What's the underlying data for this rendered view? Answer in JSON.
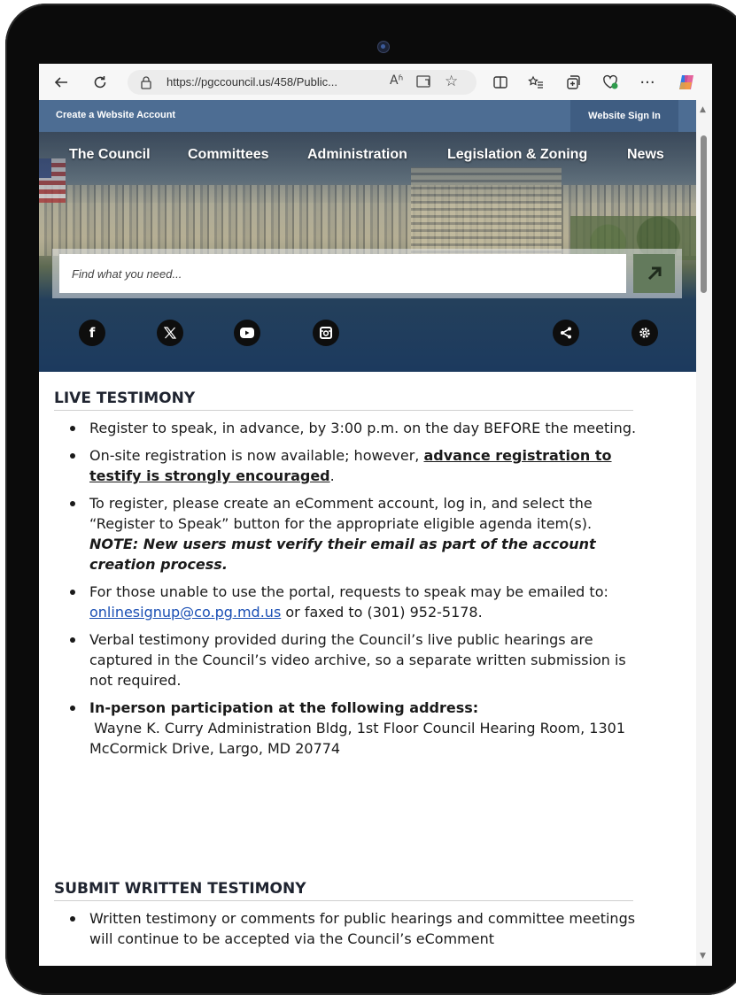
{
  "browser": {
    "url": "https://pgccouncil.us/458/Public...",
    "read_aloud_label": "Aʱ",
    "more_label": "···"
  },
  "site": {
    "topbar": {
      "create_account": "Create a Website Account",
      "sign_in": "Website Sign In"
    },
    "nav": [
      "The Council",
      "Committees",
      "Administration",
      "Legislation & Zoning",
      "News"
    ],
    "search_placeholder": "Find what you need...",
    "socials": [
      "facebook-icon",
      "x-icon",
      "youtube-icon",
      "instagram-icon"
    ],
    "right_icons": [
      "share-icon",
      "settings-icon"
    ]
  },
  "live_testimony": {
    "heading": "LIVE TESTIMONY",
    "item1": "Register to speak, in advance, by 3:00 p.m. on the day BEFORE the meeting.",
    "item2_text": "On-site registration is now available; however, ",
    "item2_link": "advance registration to testify is strongly encouraged",
    "item2_end": ".",
    "item3_text": "To register, please create an eComment account, log in, and select the “Register to Speak” button for the appropriate eligible agenda item(s). ",
    "item3_note": "NOTE: New users must verify their email as part of the account creation process.",
    "item4_text": "For those unable to use the portal, requests to speak may be emailed to: ",
    "item4_email": "onlinesignup@co.pg.md.us",
    "item4_end": " or faxed to (301) 952-5178.",
    "item5": "Verbal testimony provided during the Council’s live public hearings are captured in the Council’s video archive, so a separate written submission is not required.",
    "item6_title": "In-person participation at the following address:",
    "item6_address": " Wayne K. Curry Administration Bldg, 1st Floor Council Hearing Room, 1301 McCormick Drive, Largo, MD 20774"
  },
  "written_testimony": {
    "heading": "SUBMIT WRITTEN TESTIMONY",
    "item1": "Written testimony or comments for public hearings and committee meetings will continue to be accepted via the Council’s eComment"
  },
  "colors": {
    "topbar": "#4d6d93",
    "signin_bg": "#3f5d82",
    "search_button": "#637a5c",
    "link": "#1a4fb4"
  }
}
